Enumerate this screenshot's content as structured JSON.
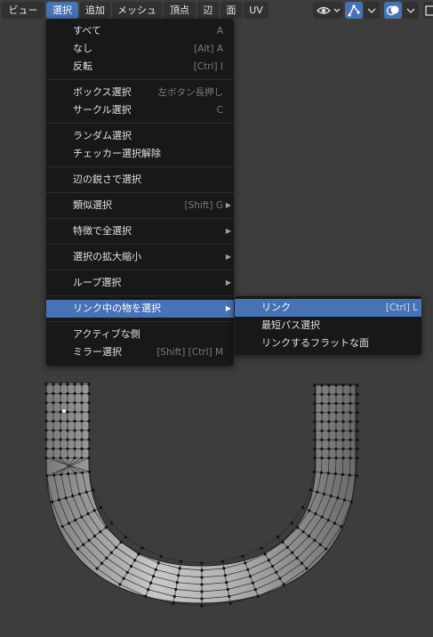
{
  "header": {
    "menus": [
      "ビュー",
      "選択",
      "追加",
      "メッシュ",
      "頂点",
      "辺",
      "面",
      "UV"
    ],
    "icons": [
      "eye-icon",
      "chevron-down-icon",
      "gizmo-icon",
      "chevron-down-icon",
      "overlay-icon",
      "chevron-down-icon",
      "xray-icon"
    ]
  },
  "select_menu": {
    "items": [
      {
        "label": "すべて",
        "shortcut": "A"
      },
      {
        "label": "なし",
        "shortcut": "[Alt] A"
      },
      {
        "label": "反転",
        "shortcut": "[Ctrl] I"
      },
      {
        "label": "ボックス選択",
        "shortcut": "左ボタン長押し"
      },
      {
        "label": "サークル選択",
        "shortcut": "C"
      },
      {
        "label": "ランダム選択",
        "shortcut": ""
      },
      {
        "label": "チェッカー選択解除",
        "shortcut": ""
      },
      {
        "label": "辺の鋭さで選択",
        "shortcut": ""
      },
      {
        "label": "類似選択",
        "shortcut": "[Shift] G"
      },
      {
        "label": "特徴で全選択",
        "shortcut": ""
      },
      {
        "label": "選択の拡大縮小",
        "shortcut": ""
      },
      {
        "label": "ループ選択",
        "shortcut": ""
      },
      {
        "label": "リンク中の物を選択",
        "shortcut": ""
      },
      {
        "label": "アクティブな側",
        "shortcut": ""
      },
      {
        "label": "ミラー選択",
        "shortcut": "[Shift] [Ctrl] M"
      }
    ]
  },
  "linked_submenu": {
    "items": [
      {
        "label": "リンク",
        "shortcut": "[Ctrl] L"
      },
      {
        "label": "最短パス選択",
        "shortcut": ""
      },
      {
        "label": "リンクするフラットな面",
        "shortcut": ""
      }
    ]
  },
  "colors": {
    "accent": "#4772b3",
    "menu_bg": "#181818",
    "viewport_bg": "#3d3d3d"
  }
}
